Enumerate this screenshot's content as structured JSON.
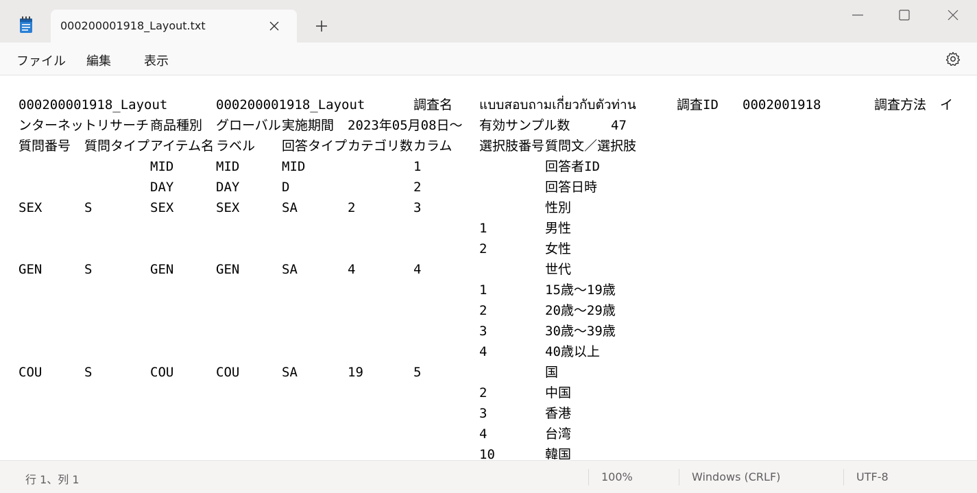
{
  "tab": {
    "title": "000200001918_Layout.txt"
  },
  "menu": {
    "file": "ファイル",
    "edit": "編集",
    "view": "表示"
  },
  "editor": {
    "lines": [
      [
        "000200001918_Layout",
        "000200001918_Layout",
        "調査名",
        "แบบสอบถามเกี่ยวกับตัวท่าน",
        "調査ID",
        "0002001918",
        "調査方法",
        "イ"
      ],
      [
        "ンターネットリサーチ",
        "商品種別",
        "グローバル",
        "実施期間",
        "2023年05月08日～",
        "有効サンプル数",
        "47"
      ],
      [
        "質問番号",
        "質問タイプ",
        "アイテム名",
        "ラベル",
        "回答タイプ",
        "カテゴリ数",
        "カラム",
        "選択肢番号",
        "質問文／選択肢"
      ],
      [
        "",
        "",
        "MID",
        "MID",
        "MID",
        "",
        "1",
        "",
        "回答者ID"
      ],
      [
        "",
        "",
        "DAY",
        "DAY",
        "D",
        "",
        "2",
        "",
        "回答日時"
      ],
      [
        "SEX",
        "S",
        "SEX",
        "SEX",
        "SA",
        "2",
        "3",
        "",
        "性別"
      ],
      [
        "",
        "",
        "",
        "",
        "",
        "",
        "",
        "1",
        "男性"
      ],
      [
        "",
        "",
        "",
        "",
        "",
        "",
        "",
        "2",
        "女性"
      ],
      [
        "GEN",
        "S",
        "GEN",
        "GEN",
        "SA",
        "4",
        "4",
        "",
        "世代"
      ],
      [
        "",
        "",
        "",
        "",
        "",
        "",
        "",
        "1",
        "15歳～19歳"
      ],
      [
        "",
        "",
        "",
        "",
        "",
        "",
        "",
        "2",
        "20歳～29歳"
      ],
      [
        "",
        "",
        "",
        "",
        "",
        "",
        "",
        "3",
        "30歳～39歳"
      ],
      [
        "",
        "",
        "",
        "",
        "",
        "",
        "",
        "4",
        "40歳以上"
      ],
      [
        "COU",
        "S",
        "COU",
        "COU",
        "SA",
        "19",
        "5",
        "",
        "国"
      ],
      [
        "",
        "",
        "",
        "",
        "",
        "",
        "",
        "2",
        "中国"
      ],
      [
        "",
        "",
        "",
        "",
        "",
        "",
        "",
        "3",
        "香港"
      ],
      [
        "",
        "",
        "",
        "",
        "",
        "",
        "",
        "4",
        "台湾"
      ],
      [
        "",
        "",
        "",
        "",
        "",
        "",
        "",
        "10",
        "韓国"
      ]
    ]
  },
  "status": {
    "position": "行 1、列 1",
    "zoom": "100%",
    "line_ending": "Windows (CRLF)",
    "encoding": "UTF-8"
  }
}
